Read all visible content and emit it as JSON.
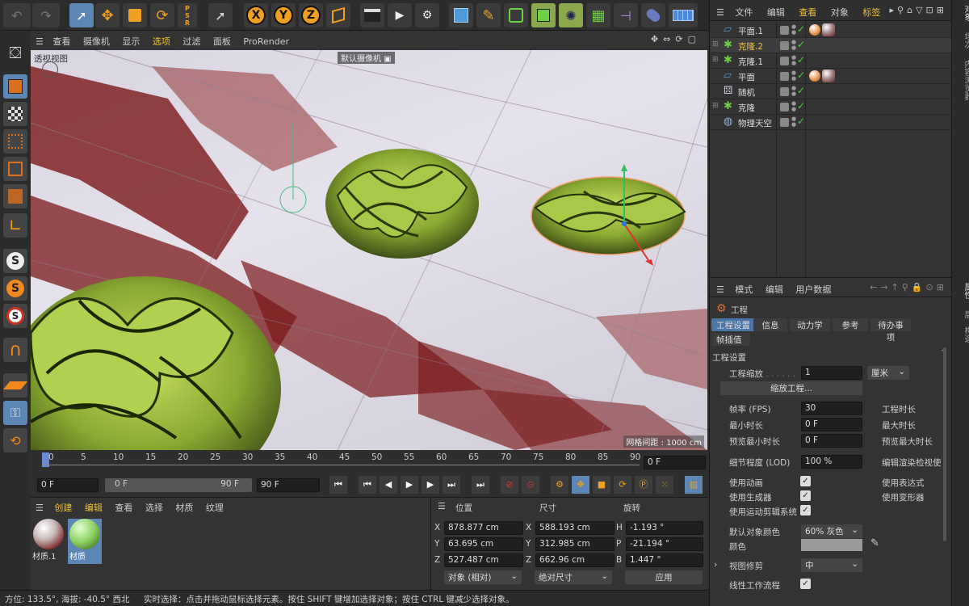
{
  "top_menu": {
    "file": "文件",
    "edit": "编辑",
    "view": "查看",
    "object": "对象",
    "tags": "标签"
  },
  "viewport": {
    "menu": [
      "查看",
      "摄像机",
      "显示",
      "选项",
      "过滤",
      "面板",
      "ProRender"
    ],
    "label": "透视视图",
    "camera": "默认摄像机",
    "grid": "网格间距 : 1000 cm"
  },
  "timeline": {
    "ticks": [
      "0",
      "5",
      "10",
      "15",
      "20",
      "25",
      "30",
      "35",
      "40",
      "45",
      "50",
      "55",
      "60",
      "65",
      "70",
      "75",
      "80",
      "85",
      "90"
    ],
    "current_frame": "0 F",
    "start": "0 F",
    "min": "0 F",
    "max": "90 F",
    "end": "90 F"
  },
  "materials": {
    "menu": [
      "创建",
      "编辑",
      "查看",
      "选择",
      "材质",
      "纹理"
    ],
    "items": [
      "材质.1",
      "材质"
    ]
  },
  "coords": {
    "headers": [
      "位置",
      "尺寸",
      "旋转"
    ],
    "rows": [
      {
        "axis": "X",
        "pos": "878.877 cm",
        "saxis": "X",
        "size": "588.193 cm",
        "raxis": "H",
        "rot": "-1.193 °"
      },
      {
        "axis": "Y",
        "pos": "63.695 cm",
        "saxis": "Y",
        "size": "312.985 cm",
        "raxis": "P",
        "rot": "-21.194 °"
      },
      {
        "axis": "Z",
        "pos": "527.487 cm",
        "saxis": "Z",
        "size": "662.96 cm",
        "raxis": "B",
        "rot": "1.447 °"
      }
    ],
    "mode": "对象 (相对)",
    "size_mode": "绝对尺寸",
    "apply": "应用"
  },
  "objects": [
    {
      "name": "平面.1",
      "icon": "plane-icon",
      "mat": true
    },
    {
      "name": "克隆.2",
      "icon": "cloner-icon",
      "mat": false,
      "active": true
    },
    {
      "name": "克隆.1",
      "icon": "cloner-icon",
      "mat": false
    },
    {
      "name": "平面",
      "icon": "plane-icon",
      "mat": true
    },
    {
      "name": "随机",
      "icon": "random-effector-icon",
      "mat": false
    },
    {
      "name": "克隆",
      "icon": "cloner-icon",
      "mat": false
    },
    {
      "name": "物理天空",
      "icon": "sky-icon",
      "mat": false
    }
  ],
  "attr": {
    "menu": [
      "模式",
      "编辑",
      "用户数据"
    ],
    "title": "工程",
    "tabs": [
      "工程设置",
      "信息",
      "动力学",
      "参考",
      "待办事项",
      "帧插值"
    ],
    "section": "工程设置",
    "scale_label": "工程缩放",
    "scale_value": "1",
    "scale_unit": "厘米",
    "scale_btn": "缩放工程...",
    "fps_label": "帧率 (FPS)",
    "fps": "30",
    "duration_label": "工程时长",
    "min_label": "最小时长",
    "min": "0 F",
    "max_label": "最大时长",
    "pmin_label": "预览最小时长",
    "pmin": "0 F",
    "pmax_label": "预览最大时长",
    "lod_label": "细节程度 (LOD)",
    "lod": "100 %",
    "render_lod_label": "编辑渲染检视使",
    "anim_label": "使用动画",
    "expr_label": "使用表达式",
    "gen_label": "使用生成器",
    "deform_label": "使用变形器",
    "motion_label": "使用运动剪辑系统",
    "objcolor_label": "默认对象颜色",
    "objcolor": "60% 灰色",
    "color_label": "颜色",
    "viewclip_label": "视图修剪",
    "viewclip": "中",
    "linear_label": "线性工作流程"
  },
  "side_tabs": {
    "top": [
      "对象",
      "场次",
      "内容浏览器"
    ],
    "bottom": [
      "属性",
      "层",
      "构造"
    ]
  },
  "status": {
    "left": "方位: 133.5°, 海拔: -40.5° 西北",
    "msg": "实时选择：点击并拖动鼠标选择元素。按住 SHIFT 键增加选择对象；按住 CTRL 键减少选择对象。"
  },
  "colors": {
    "accent": "#4b76a8",
    "active": "#f0c030",
    "green": "#8fb838"
  }
}
